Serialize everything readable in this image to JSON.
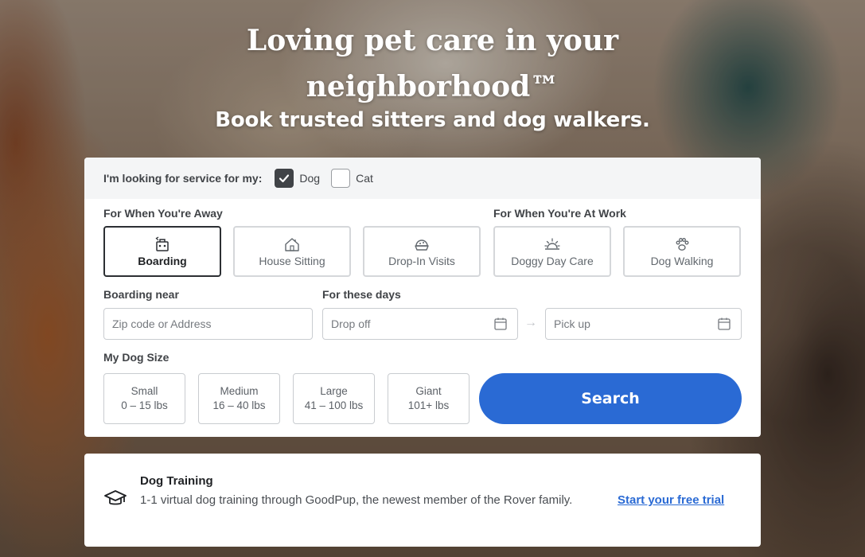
{
  "hero": {
    "title": "Loving pet care in your neighborhood™",
    "subtitle": "Book trusted sitters and dog walkers."
  },
  "pet_selector": {
    "prompt": "I'm looking for service for my:",
    "options": [
      {
        "label": "Dog",
        "checked": true
      },
      {
        "label": "Cat",
        "checked": false
      }
    ]
  },
  "services": {
    "away_label": "For When You're Away",
    "work_label": "For When You're At Work",
    "items": [
      {
        "label": "Boarding",
        "icon": "boarding-icon",
        "active": true
      },
      {
        "label": "House Sitting",
        "icon": "house-icon",
        "active": false
      },
      {
        "label": "Drop-In Visits",
        "icon": "food-bowl-icon",
        "active": false
      },
      {
        "label": "Doggy Day Care",
        "icon": "sun-icon",
        "active": false
      },
      {
        "label": "Dog Walking",
        "icon": "paw-icon",
        "active": false
      }
    ]
  },
  "location": {
    "label": "Boarding near",
    "placeholder": "Zip code or Address"
  },
  "dates": {
    "label": "For these days",
    "dropoff_placeholder": "Drop off",
    "pickup_placeholder": "Pick up"
  },
  "dog_size": {
    "label": "My Dog Size",
    "options": [
      {
        "name": "Small",
        "range": "0 – 15 lbs"
      },
      {
        "name": "Medium",
        "range": "16 – 40 lbs"
      },
      {
        "name": "Large",
        "range": "41 – 100 lbs"
      },
      {
        "name": "Giant",
        "range": "101+ lbs"
      }
    ]
  },
  "search": {
    "label": "Search"
  },
  "promo": {
    "title": "Dog Training",
    "description": "1-1 virtual dog training through GoodPup, the newest member of the Rover family.",
    "link": "Start your free trial"
  },
  "colors": {
    "primary": "#2a6ad4",
    "text_dark": "#1f2124",
    "border": "#c9ccd0"
  }
}
